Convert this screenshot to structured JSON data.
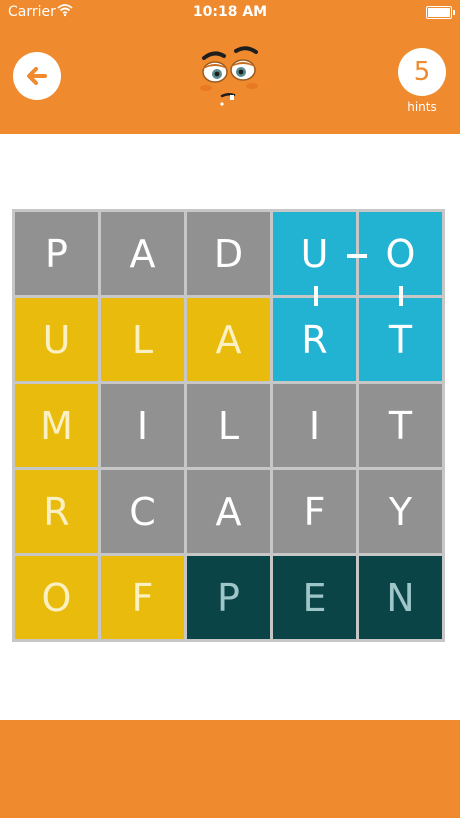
{
  "status_bar": {
    "carrier": "Carrier",
    "time": "10:18 AM"
  },
  "header": {
    "hints_count": "5",
    "hints_label": "hints",
    "icons": {
      "back": "arrow-left-icon",
      "mascot": "grumpy-face-icon"
    }
  },
  "colors": {
    "accent": "#ef8a2f",
    "gray": "#919191",
    "yellow": "#e9bb0d",
    "blue": "#22b3d3",
    "dark": "#0b4447"
  },
  "board": {
    "rows": [
      [
        {
          "letter": "P",
          "state": "gray"
        },
        {
          "letter": "A",
          "state": "gray"
        },
        {
          "letter": "D",
          "state": "gray"
        },
        {
          "letter": "U",
          "state": "blue"
        },
        {
          "letter": "O",
          "state": "blue"
        }
      ],
      [
        {
          "letter": "U",
          "state": "yellow"
        },
        {
          "letter": "L",
          "state": "yellow"
        },
        {
          "letter": "A",
          "state": "yellow"
        },
        {
          "letter": "R",
          "state": "blue"
        },
        {
          "letter": "T",
          "state": "blue"
        }
      ],
      [
        {
          "letter": "M",
          "state": "yellow"
        },
        {
          "letter": "I",
          "state": "gray"
        },
        {
          "letter": "L",
          "state": "gray"
        },
        {
          "letter": "I",
          "state": "gray"
        },
        {
          "letter": "T",
          "state": "gray"
        }
      ],
      [
        {
          "letter": "R",
          "state": "yellow"
        },
        {
          "letter": "C",
          "state": "gray"
        },
        {
          "letter": "A",
          "state": "gray"
        },
        {
          "letter": "F",
          "state": "gray"
        },
        {
          "letter": "Y",
          "state": "gray"
        }
      ],
      [
        {
          "letter": "O",
          "state": "yellow"
        },
        {
          "letter": "F",
          "state": "yellow"
        },
        {
          "letter": "P",
          "state": "dark"
        },
        {
          "letter": "E",
          "state": "dark"
        },
        {
          "letter": "N",
          "state": "dark"
        }
      ]
    ]
  }
}
